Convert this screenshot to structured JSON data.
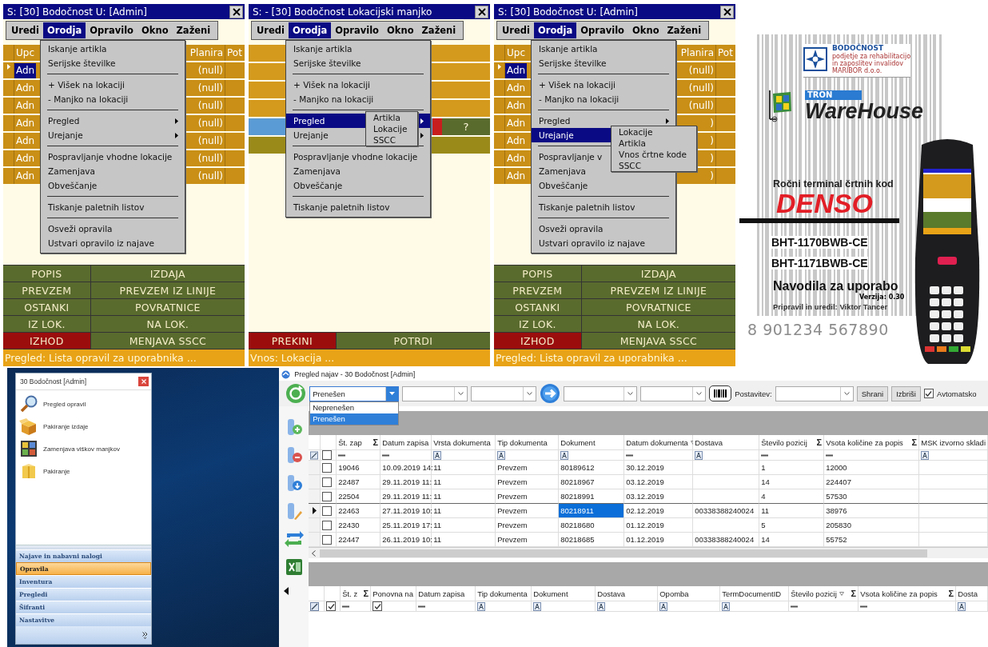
{
  "handhelds": [
    {
      "title": "S: [30] Bodočnost  U: [Admin]",
      "menubar": [
        {
          "label": "Uredi",
          "selected": false
        },
        {
          "label": "Orodja",
          "selected": true
        },
        {
          "label": "Opravilo",
          "selected": false
        },
        {
          "label": "Okno",
          "selected": false
        },
        {
          "label": "Zaženi",
          "selected": false
        }
      ],
      "content": {
        "kind": "table",
        "columns": [
          "Upc",
          "Planira",
          "Pot"
        ],
        "rows": [
          {
            "name": "Adn",
            "value": "(null)",
            "selected": true
          },
          {
            "name": "Adn",
            "value": "(null)",
            "selected": false
          },
          {
            "name": "Adn",
            "value": "(null)",
            "selected": false
          },
          {
            "name": "Adn",
            "value": "(null)",
            "selected": false
          },
          {
            "name": "Adn",
            "value": "(null)",
            "selected": false
          },
          {
            "name": "Adn",
            "value": "(null)",
            "selected": false
          },
          {
            "name": "Adn",
            "value": "(null)",
            "selected": false
          }
        ]
      },
      "menu": [
        {
          "kind": "item",
          "label": "Iskanje artikla",
          "has_submenu": false,
          "selected": false
        },
        {
          "kind": "item",
          "label": "Serijske številke",
          "has_submenu": false,
          "selected": false
        },
        {
          "kind": "separator"
        },
        {
          "kind": "item",
          "label": "+ Višek na lokaciji",
          "has_submenu": false,
          "selected": false
        },
        {
          "kind": "item",
          "label": "- Manjko na lokaciji",
          "has_submenu": false,
          "selected": false
        },
        {
          "kind": "separator"
        },
        {
          "kind": "item",
          "label": "Pregled",
          "has_submenu": true,
          "selected": false
        },
        {
          "kind": "item",
          "label": "Urejanje",
          "has_submenu": true,
          "selected": false
        },
        {
          "kind": "separator"
        },
        {
          "kind": "item",
          "label": "Pospravljanje vhodne lokacije",
          "has_submenu": false,
          "selected": false
        },
        {
          "kind": "item",
          "label": "Zamenjava",
          "has_submenu": false,
          "selected": false
        },
        {
          "kind": "item",
          "label": "Obveščanje",
          "has_submenu": false,
          "selected": false
        },
        {
          "kind": "separator"
        },
        {
          "kind": "item",
          "label": "Tiskanje paletnih listov",
          "has_submenu": false,
          "selected": false
        },
        {
          "kind": "separator"
        },
        {
          "kind": "item",
          "label": "Osveži opravila",
          "has_submenu": false,
          "selected": false
        },
        {
          "kind": "item",
          "label": "Ustvari opravilo iz najave",
          "has_submenu": false,
          "selected": false
        }
      ],
      "buttons": [
        {
          "label": "POPIS",
          "kind": "normal"
        },
        {
          "label": "IZDAJA",
          "kind": "normal"
        },
        {
          "label": "PREVZEM",
          "kind": "normal"
        },
        {
          "label": "PREVZEM IZ LINIJE",
          "kind": "normal"
        },
        {
          "label": "OSTANKI",
          "kind": "normal"
        },
        {
          "label": "POVRATNICE",
          "kind": "normal"
        },
        {
          "label": "IZ LOK.",
          "kind": "normal"
        },
        {
          "label": "NA LOK.",
          "kind": "normal"
        },
        {
          "label": "IZHOD",
          "kind": "exit"
        },
        {
          "label": "MENJAVA SSCC",
          "kind": "normal"
        }
      ],
      "status": "Pregled: Lista opravil za uporabnika ..."
    },
    {
      "title": "S: - [30] Bodočnost Lokacijski manjko",
      "menubar": [
        {
          "label": "Uredi",
          "selected": false
        },
        {
          "label": "Orodja",
          "selected": true
        },
        {
          "label": "Opravilo",
          "selected": false
        },
        {
          "label": "Okno",
          "selected": false
        },
        {
          "label": "Zaženi",
          "selected": false
        }
      ],
      "content": {
        "kind": "form",
        "rows": [
          {
            "kind": "field"
          },
          {
            "kind": "field"
          },
          {
            "kind": "field"
          },
          {
            "kind": "field"
          },
          {
            "kind": "scan",
            "button": "?"
          },
          {
            "kind": "info"
          }
        ]
      },
      "menu": [
        {
          "kind": "item",
          "label": "Iskanje artikla",
          "has_submenu": false,
          "selected": false
        },
        {
          "kind": "item",
          "label": "Serijske številke",
          "has_submenu": false,
          "selected": false
        },
        {
          "kind": "separator"
        },
        {
          "kind": "item",
          "label": "+ Višek na lokaciji",
          "has_submenu": false,
          "selected": false
        },
        {
          "kind": "item",
          "label": "- Manjko na lokaciji",
          "has_submenu": false,
          "selected": false
        },
        {
          "kind": "separator"
        },
        {
          "kind": "item",
          "label": "Pregled",
          "has_submenu": true,
          "selected": true
        },
        {
          "kind": "item",
          "label": "Urejanje",
          "has_submenu": true,
          "selected": false
        },
        {
          "kind": "separator"
        },
        {
          "kind": "item",
          "label": "Pospravljanje vhodne lokacije",
          "has_submenu": false,
          "selected": false
        },
        {
          "kind": "item",
          "label": "Zamenjava",
          "has_submenu": false,
          "selected": false
        },
        {
          "kind": "item",
          "label": "Obveščanje",
          "has_submenu": false,
          "selected": false
        },
        {
          "kind": "separator"
        },
        {
          "kind": "item",
          "label": "Tiskanje paletnih listov",
          "has_submenu": false,
          "selected": false
        }
      ],
      "submenu": [
        "Artikla",
        "Lokacije",
        "SSCC"
      ],
      "buttons": [
        {
          "label": "PREKINI",
          "kind": "exit"
        },
        {
          "label": "POTRDI",
          "kind": "normal"
        }
      ],
      "status": "Vnos: Lokacija ..."
    },
    {
      "title": "S: [30] Bodočnost  U: [Admin]",
      "menubar": [
        {
          "label": "Uredi",
          "selected": false
        },
        {
          "label": "Orodja",
          "selected": true
        },
        {
          "label": "Opravilo",
          "selected": false
        },
        {
          "label": "Okno",
          "selected": false
        },
        {
          "label": "Zaženi",
          "selected": false
        }
      ],
      "content": {
        "kind": "table",
        "columns": [
          "Upc",
          "Planira",
          "Pot"
        ],
        "rows": [
          {
            "name": "Adn",
            "value": "(null)",
            "selected": true
          },
          {
            "name": "Adn",
            "value": "(null)",
            "selected": false
          },
          {
            "name": "Adn",
            "value": "(null)",
            "selected": false
          },
          {
            "name": "Adn",
            "value": ")",
            "selected": false
          },
          {
            "name": "Adn",
            "value": ")",
            "selected": false
          },
          {
            "name": "Adn",
            "value": ")",
            "selected": false
          },
          {
            "name": "Adn",
            "value": ")",
            "selected": false
          }
        ]
      },
      "menu": [
        {
          "kind": "item",
          "label": "Iskanje artikla",
          "has_submenu": false,
          "selected": false
        },
        {
          "kind": "item",
          "label": "Serijske številke",
          "has_submenu": false,
          "selected": false
        },
        {
          "kind": "separator"
        },
        {
          "kind": "item",
          "label": "+ Višek na lokaciji",
          "has_submenu": false,
          "selected": false
        },
        {
          "kind": "item",
          "label": "- Manjko na lokaciji",
          "has_submenu": false,
          "selected": false
        },
        {
          "kind": "separator"
        },
        {
          "kind": "item",
          "label": "Pregled",
          "has_submenu": true,
          "selected": false
        },
        {
          "kind": "item",
          "label": "Urejanje",
          "has_submenu": false,
          "selected": true
        },
        {
          "kind": "separator"
        },
        {
          "kind": "item",
          "label": "Pospravljanje v",
          "has_submenu": false,
          "selected": false
        },
        {
          "kind": "item",
          "label": "Zamenjava",
          "has_submenu": false,
          "selected": false
        },
        {
          "kind": "item",
          "label": "Obveščanje",
          "has_submenu": false,
          "selected": false
        },
        {
          "kind": "separator"
        },
        {
          "kind": "item",
          "label": "Tiskanje paletnih listov",
          "has_submenu": false,
          "selected": false
        },
        {
          "kind": "separator"
        },
        {
          "kind": "item",
          "label": "Osveži opravila",
          "has_submenu": false,
          "selected": false
        },
        {
          "kind": "item",
          "label": "Ustvari opravilo iz najave",
          "has_submenu": false,
          "selected": false
        }
      ],
      "submenu": [
        "Lokacije",
        "Artikla",
        "Vnos črtne kode",
        "SSCC"
      ],
      "buttons": [
        {
          "label": "POPIS",
          "kind": "normal"
        },
        {
          "label": "IZDAJA",
          "kind": "normal"
        },
        {
          "label": "PREVZEM",
          "kind": "normal"
        },
        {
          "label": "PREVZEM IZ LINIJE",
          "kind": "normal"
        },
        {
          "label": "OSTANKI",
          "kind": "normal"
        },
        {
          "label": "POVRATNICE",
          "kind": "normal"
        },
        {
          "label": "IZ LOK.",
          "kind": "normal"
        },
        {
          "label": "NA LOK.",
          "kind": "normal"
        },
        {
          "label": "IZHOD",
          "kind": "exit"
        },
        {
          "label": "MENJAVA SSCC",
          "kind": "normal"
        }
      ],
      "status": "Pregled: Lista opravil za uporabnika ..."
    }
  ],
  "cover": {
    "company": {
      "name": "BODOČNOST",
      "lines": [
        "podjetje za rehabilitacijo",
        "in zaposlitev invalidov",
        "MARIBOR d.o.o."
      ]
    },
    "product": {
      "badge": "TRON",
      "name": "WareHouse"
    },
    "subtitle": "Ročni terminal črtnih kod",
    "brand": "DENSO",
    "models": [
      "BHT-1170BWB-CE",
      "BHT-1171BWB-CE"
    ],
    "heading": "Navodila za uporabo",
    "version": "Verzija: 0.30",
    "author": "Pripravil in uredil: Viktor Tancer",
    "barcode_number": "8 901234 567890"
  },
  "launcher": {
    "title": "30 Bodočnost [Admin]",
    "items": [
      {
        "label": "Pregled opravil",
        "kind": "search"
      },
      {
        "label": "Pakiranje izdaje",
        "kind": "open_box"
      },
      {
        "label": "Zamenjava viškov manjkov",
        "kind": "tiles"
      },
      {
        "label": "Pakiranje",
        "kind": "box"
      }
    ],
    "groups": [
      {
        "label": "Najave in nabavni nalogi",
        "selected": false
      },
      {
        "label": "Opravila",
        "selected": true
      },
      {
        "label": "Inventura",
        "selected": false
      },
      {
        "label": "Pregledi",
        "selected": false
      },
      {
        "label": "Šifranti",
        "selected": false
      },
      {
        "label": "Nastavitve",
        "selected": false
      }
    ]
  },
  "najave": {
    "title": "Pregled najav - 30 Bodočnost [Admin]",
    "status_combo": {
      "value": "Prenešen",
      "open": true,
      "options": [
        {
          "label": "Neprenešen",
          "selected": false
        },
        {
          "label": "Prenešen",
          "selected": true
        }
      ]
    },
    "layout_label": "Postavitev:",
    "buttons": [
      "Shrani",
      "Izbriši"
    ],
    "auto": {
      "label": "Avtomatsko",
      "checked": true
    },
    "top_grid": {
      "selector_filter": {
        "kind": "clear"
      },
      "check_filter": {
        "kind": "checkbox",
        "checked": false
      },
      "columns": [
        {
          "label": "Št. zap",
          "summary": "Σ",
          "sorted": false,
          "filter": {
            "kind": "number"
          }
        },
        {
          "label": "Datum zapisa",
          "sorted": false,
          "filter": {
            "kind": "number"
          }
        },
        {
          "label": "Vrsta dokumenta",
          "sorted": false,
          "filter": {
            "kind": "text"
          }
        },
        {
          "label": "Tip dokumenta",
          "sorted": false,
          "filter": {
            "kind": "text"
          }
        },
        {
          "label": "Dokument",
          "sorted": false,
          "focused": true,
          "filter": {
            "kind": "text"
          }
        },
        {
          "label": "Datum dokumenta",
          "sorted": true,
          "filter": {
            "kind": "number"
          }
        },
        {
          "label": "Dostava",
          "sorted": false,
          "filter": {
            "kind": "text"
          }
        },
        {
          "label": "Število pozicij",
          "summary": "Σ",
          "sorted": false,
          "filter": {
            "kind": "number"
          }
        },
        {
          "label": "Vsota količine za popis",
          "summary": "Σ",
          "sorted": false,
          "filter": {
            "kind": "number"
          }
        },
        {
          "label": "MSK izvorno skladi",
          "sorted": false,
          "filter": {
            "kind": "text"
          }
        }
      ],
      "rows": [
        {
          "current": false,
          "checked": false,
          "cells": [
            "19046",
            "10.09.2019 14:",
            "11",
            "Prevzem",
            "80189612",
            "30.12.2019",
            null,
            "1",
            "12000",
            null
          ]
        },
        {
          "current": false,
          "checked": false,
          "cells": [
            "22487",
            "29.11.2019 11:",
            "11",
            "Prevzem",
            "80218967",
            "03.12.2019",
            null,
            "14",
            "224407",
            null
          ]
        },
        {
          "current": false,
          "checked": false,
          "cells": [
            "22504",
            "29.11.2019 11:",
            "11",
            "Prevzem",
            "80218991",
            "03.12.2019",
            null,
            "4",
            "57530",
            null
          ]
        },
        {
          "current": true,
          "checked": false,
          "cells": [
            "22463",
            "27.11.2019 10:",
            "11",
            "Prevzem",
            "80218911",
            "02.12.2019",
            "00338388240024",
            "11",
            "38976",
            null
          ]
        },
        {
          "current": false,
          "checked": false,
          "cells": [
            "22430",
            "25.11.2019 17:",
            "11",
            "Prevzem",
            "80218680",
            "01.12.2019",
            null,
            "5",
            "205830",
            null
          ]
        },
        {
          "current": false,
          "checked": false,
          "cells": [
            "22447",
            "26.11.2019 10:",
            "11",
            "Prevzem",
            "80218685",
            "01.12.2019",
            "00338388240024",
            "14",
            "55752",
            null
          ]
        }
      ]
    },
    "bottom_grid": {
      "selector_filter": {
        "kind": "clear"
      },
      "check_filter": {
        "kind": "checkbox",
        "checked": true
      },
      "columns": [
        {
          "label": "Št. z",
          "summary": "Σ",
          "sorted": false,
          "filter": {
            "kind": "number"
          }
        },
        {
          "label": "Ponovna na",
          "sorted": false,
          "filter": {
            "kind": "checkbox",
            "checked": true
          }
        },
        {
          "label": "Datum zapisa",
          "sorted": false,
          "filter": {
            "kind": "number"
          }
        },
        {
          "label": "Tip dokumenta",
          "sorted": false,
          "filter": {
            "kind": "text"
          }
        },
        {
          "label": "Dokument",
          "sorted": false,
          "filter": {
            "kind": "text"
          }
        },
        {
          "label": "Dostava",
          "sorted": false,
          "filter": {
            "kind": "text"
          }
        },
        {
          "label": "Opomba",
          "sorted": false,
          "filter": {
            "kind": "text"
          }
        },
        {
          "label": "TermDocumentID",
          "sorted": false,
          "filter": {
            "kind": "text"
          }
        },
        {
          "label": "Število pozicij",
          "summary": "Σ",
          "sorted": true,
          "filter": {
            "kind": "number"
          }
        },
        {
          "label": "Vsota količine za popis",
          "summary": "Σ",
          "sorted": false,
          "filter": {
            "kind": "number"
          }
        },
        {
          "label": "Dosta",
          "sorted": false,
          "filter": {
            "kind": "text"
          }
        }
      ]
    }
  }
}
